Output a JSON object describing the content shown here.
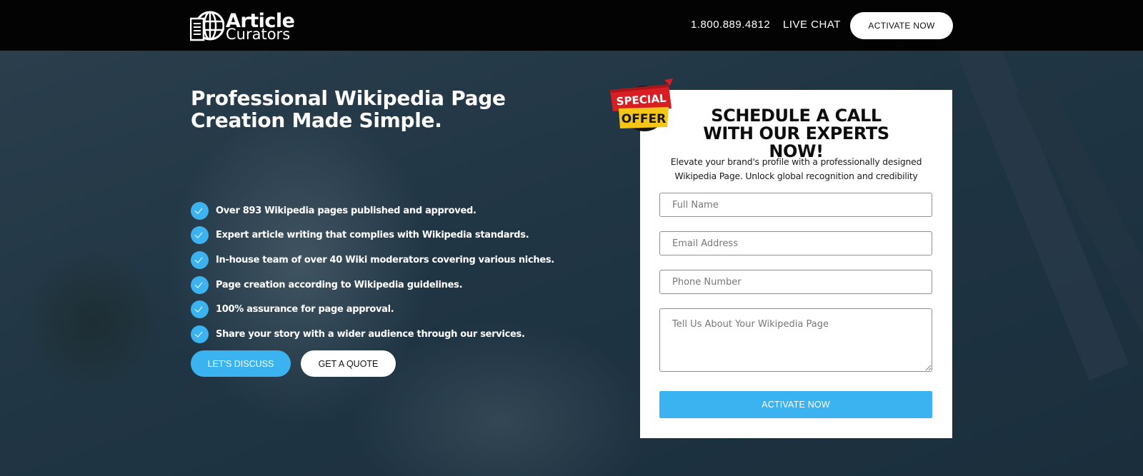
{
  "header": {
    "logo": {
      "line1": "Article",
      "line2": "Curators"
    },
    "phone": "1.800.889.4812",
    "live_chat": "LIVE CHAT",
    "cta": "ACTIVATE NOW"
  },
  "hero": {
    "title": "Professional Wikipedia Page Creation Made Simple.",
    "features": [
      "Over 893 Wikipedia pages published and approved.",
      "Expert article writing that complies with Wikipedia standards.",
      "In-house team of over 40 Wiki moderators covering various niches.",
      "Page creation according to Wikipedia guidelines.",
      "100% assurance for page approval.",
      "Share your story with a wider audience through our services."
    ],
    "primary_button": "LET'S DISCUSS",
    "secondary_button": "GET A QUOTE"
  },
  "badge": {
    "line1": "SPECIAL",
    "line2": "OFFER"
  },
  "form": {
    "title": "SCHEDULE A CALL WITH OUR EXPERTS NOW!",
    "subtitle": "Elevate your brand's profile with a professionally designed Wikipedia Page. Unlock global recognition and credibility",
    "full_name_placeholder": "Full Name",
    "email_placeholder": "Email Address",
    "phone_placeholder": "Phone Number",
    "message_placeholder": "Tell Us About Your Wikipedia Page",
    "submit": "ACTIVATE NOW"
  },
  "colors": {
    "accent": "#3cb3f1",
    "header_bg": "#030303",
    "hero_overlay": "#1d3140",
    "badge_red": "#d81e22",
    "badge_yellow": "#f5c518"
  },
  "icons": [
    "logo-book-globe-icon",
    "check-icon",
    "special-offer-badge"
  ]
}
